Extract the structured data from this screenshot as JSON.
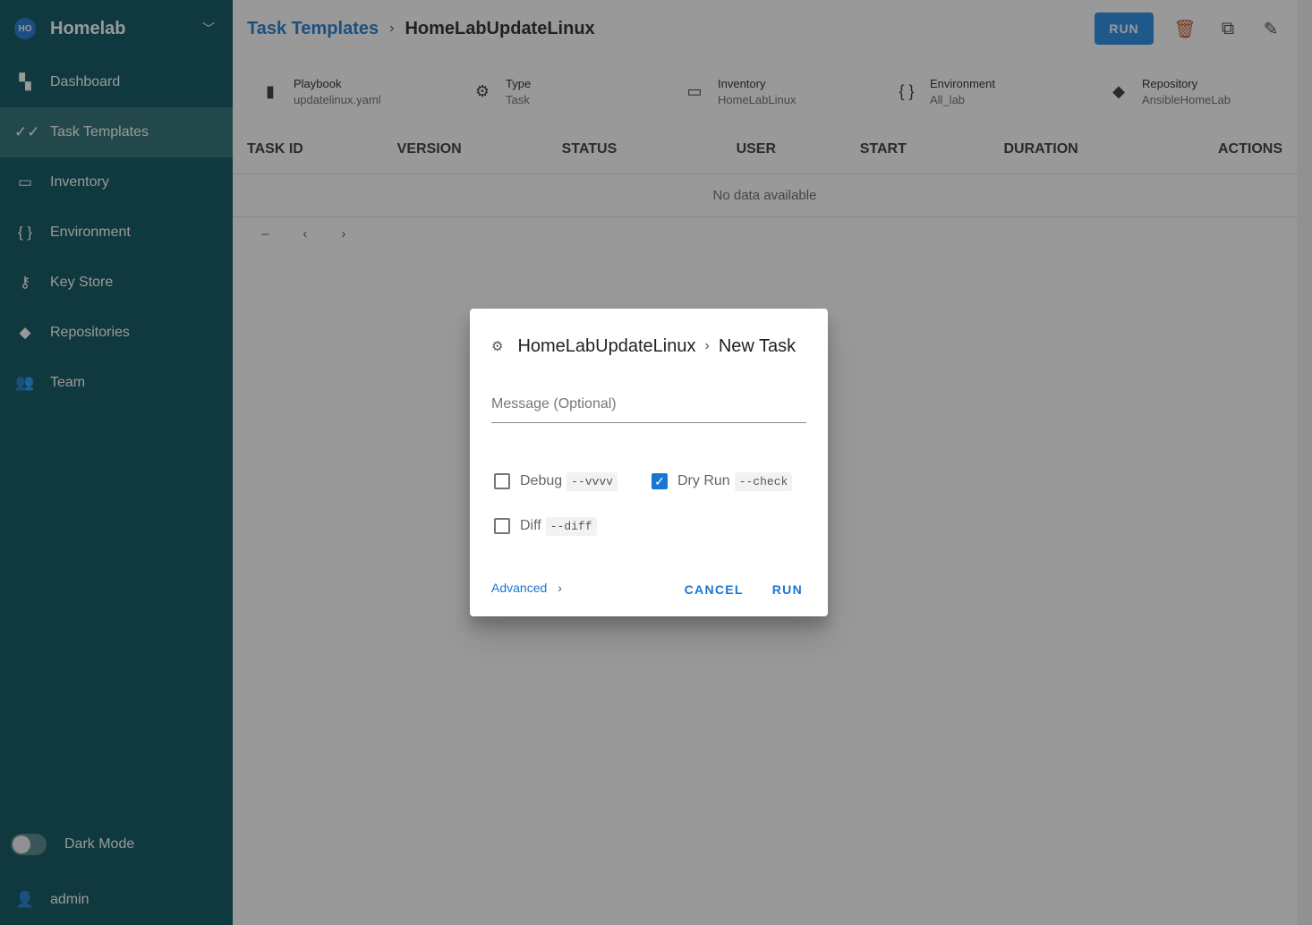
{
  "sidebar": {
    "project_initials": "HO",
    "project_name": "Homelab",
    "items": [
      {
        "label": "Dashboard",
        "icon": "▚"
      },
      {
        "label": "Task Templates",
        "icon": "✓✓"
      },
      {
        "label": "Inventory",
        "icon": "🖵"
      },
      {
        "label": "Environment",
        "icon": "{}"
      },
      {
        "label": "Key Store",
        "icon": "⚷"
      },
      {
        "label": "Repositories",
        "icon": "◆"
      },
      {
        "label": "Team",
        "icon": "👥"
      }
    ],
    "dark_mode": "Dark Mode",
    "user": "admin"
  },
  "header": {
    "breadcrumb_parent": "Task Templates",
    "breadcrumb_current": "HomeLabUpdateLinux",
    "run": "RUN"
  },
  "info": [
    {
      "title": "Playbook",
      "value": "updatelinux.yaml",
      "icon": "▮"
    },
    {
      "title": "Type",
      "value": "Task",
      "icon": "⚙"
    },
    {
      "title": "Inventory",
      "value": "HomeLabLinux",
      "icon": "🖵"
    },
    {
      "title": "Environment",
      "value": "All_lab",
      "icon": "{}"
    },
    {
      "title": "Repository",
      "value": "AnsibleHomeLab",
      "icon": "◆"
    }
  ],
  "table": {
    "headers": [
      "TASK ID",
      "VERSION",
      "STATUS",
      "USER",
      "START",
      "DURATION",
      "ACTIONS"
    ],
    "empty": "No data available",
    "pager": "–"
  },
  "dialog": {
    "title": "HomeLabUpdateLinux",
    "subtitle": "New Task",
    "message_placeholder": "Message (Optional)",
    "options": [
      {
        "label": "Debug",
        "flag": "--vvvv",
        "checked": false
      },
      {
        "label": "Dry Run",
        "flag": "--check",
        "checked": true
      },
      {
        "label": "Diff",
        "flag": "--diff",
        "checked": false
      }
    ],
    "advanced": "Advanced",
    "cancel": "CANCEL",
    "run": "RUN"
  }
}
